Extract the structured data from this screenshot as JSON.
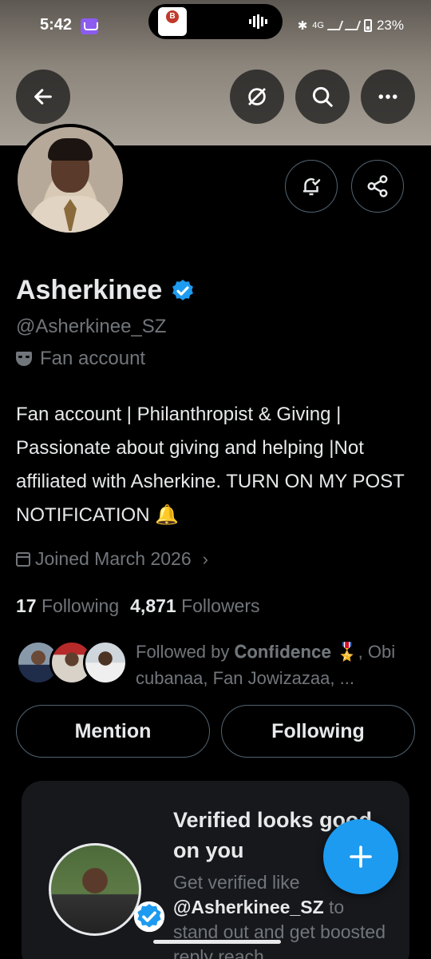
{
  "status_bar": {
    "time": "5:42",
    "network": "4G",
    "battery": "23%"
  },
  "profile": {
    "name": "Asherkinee",
    "handle": "@Asherkinee_SZ",
    "label": "Fan account",
    "bio": "Fan account | Philanthropist & Giving | Passionate about giving and helping |Not affiliated with Asherkine. TURN ON MY POST NOTIFICATION 🔔",
    "joined": "Joined March 2026",
    "following_count": "17",
    "following_label": "Following",
    "followers_count": "4,871",
    "followers_label": "Followers",
    "followed_by": "Followed by 𝐂𝐨𝐧𝐟𝐢𝐝𝐞𝐧𝐜𝐞 🎖️, Obi cubanaa, Fan Jowizazaa, ..."
  },
  "actions": {
    "mention": "Mention",
    "following": "Following"
  },
  "promo": {
    "title": "Verified looks good on you",
    "sub_prefix": "Get verified like",
    "sub_handle": "@Asherkinee_SZ",
    "sub_suffix": "to stand out and get boosted reply reach"
  },
  "colors": {
    "accent": "#1d9bf0",
    "muted": "#71767b",
    "background": "#000000"
  },
  "icons": [
    "back-arrow-icon",
    "grok-icon",
    "search-icon",
    "more-icon",
    "notification-bell-icon",
    "share-icon",
    "verified-badge-icon",
    "fan-mask-icon",
    "calendar-icon",
    "chevron-right-icon",
    "compose-plus-icon"
  ]
}
